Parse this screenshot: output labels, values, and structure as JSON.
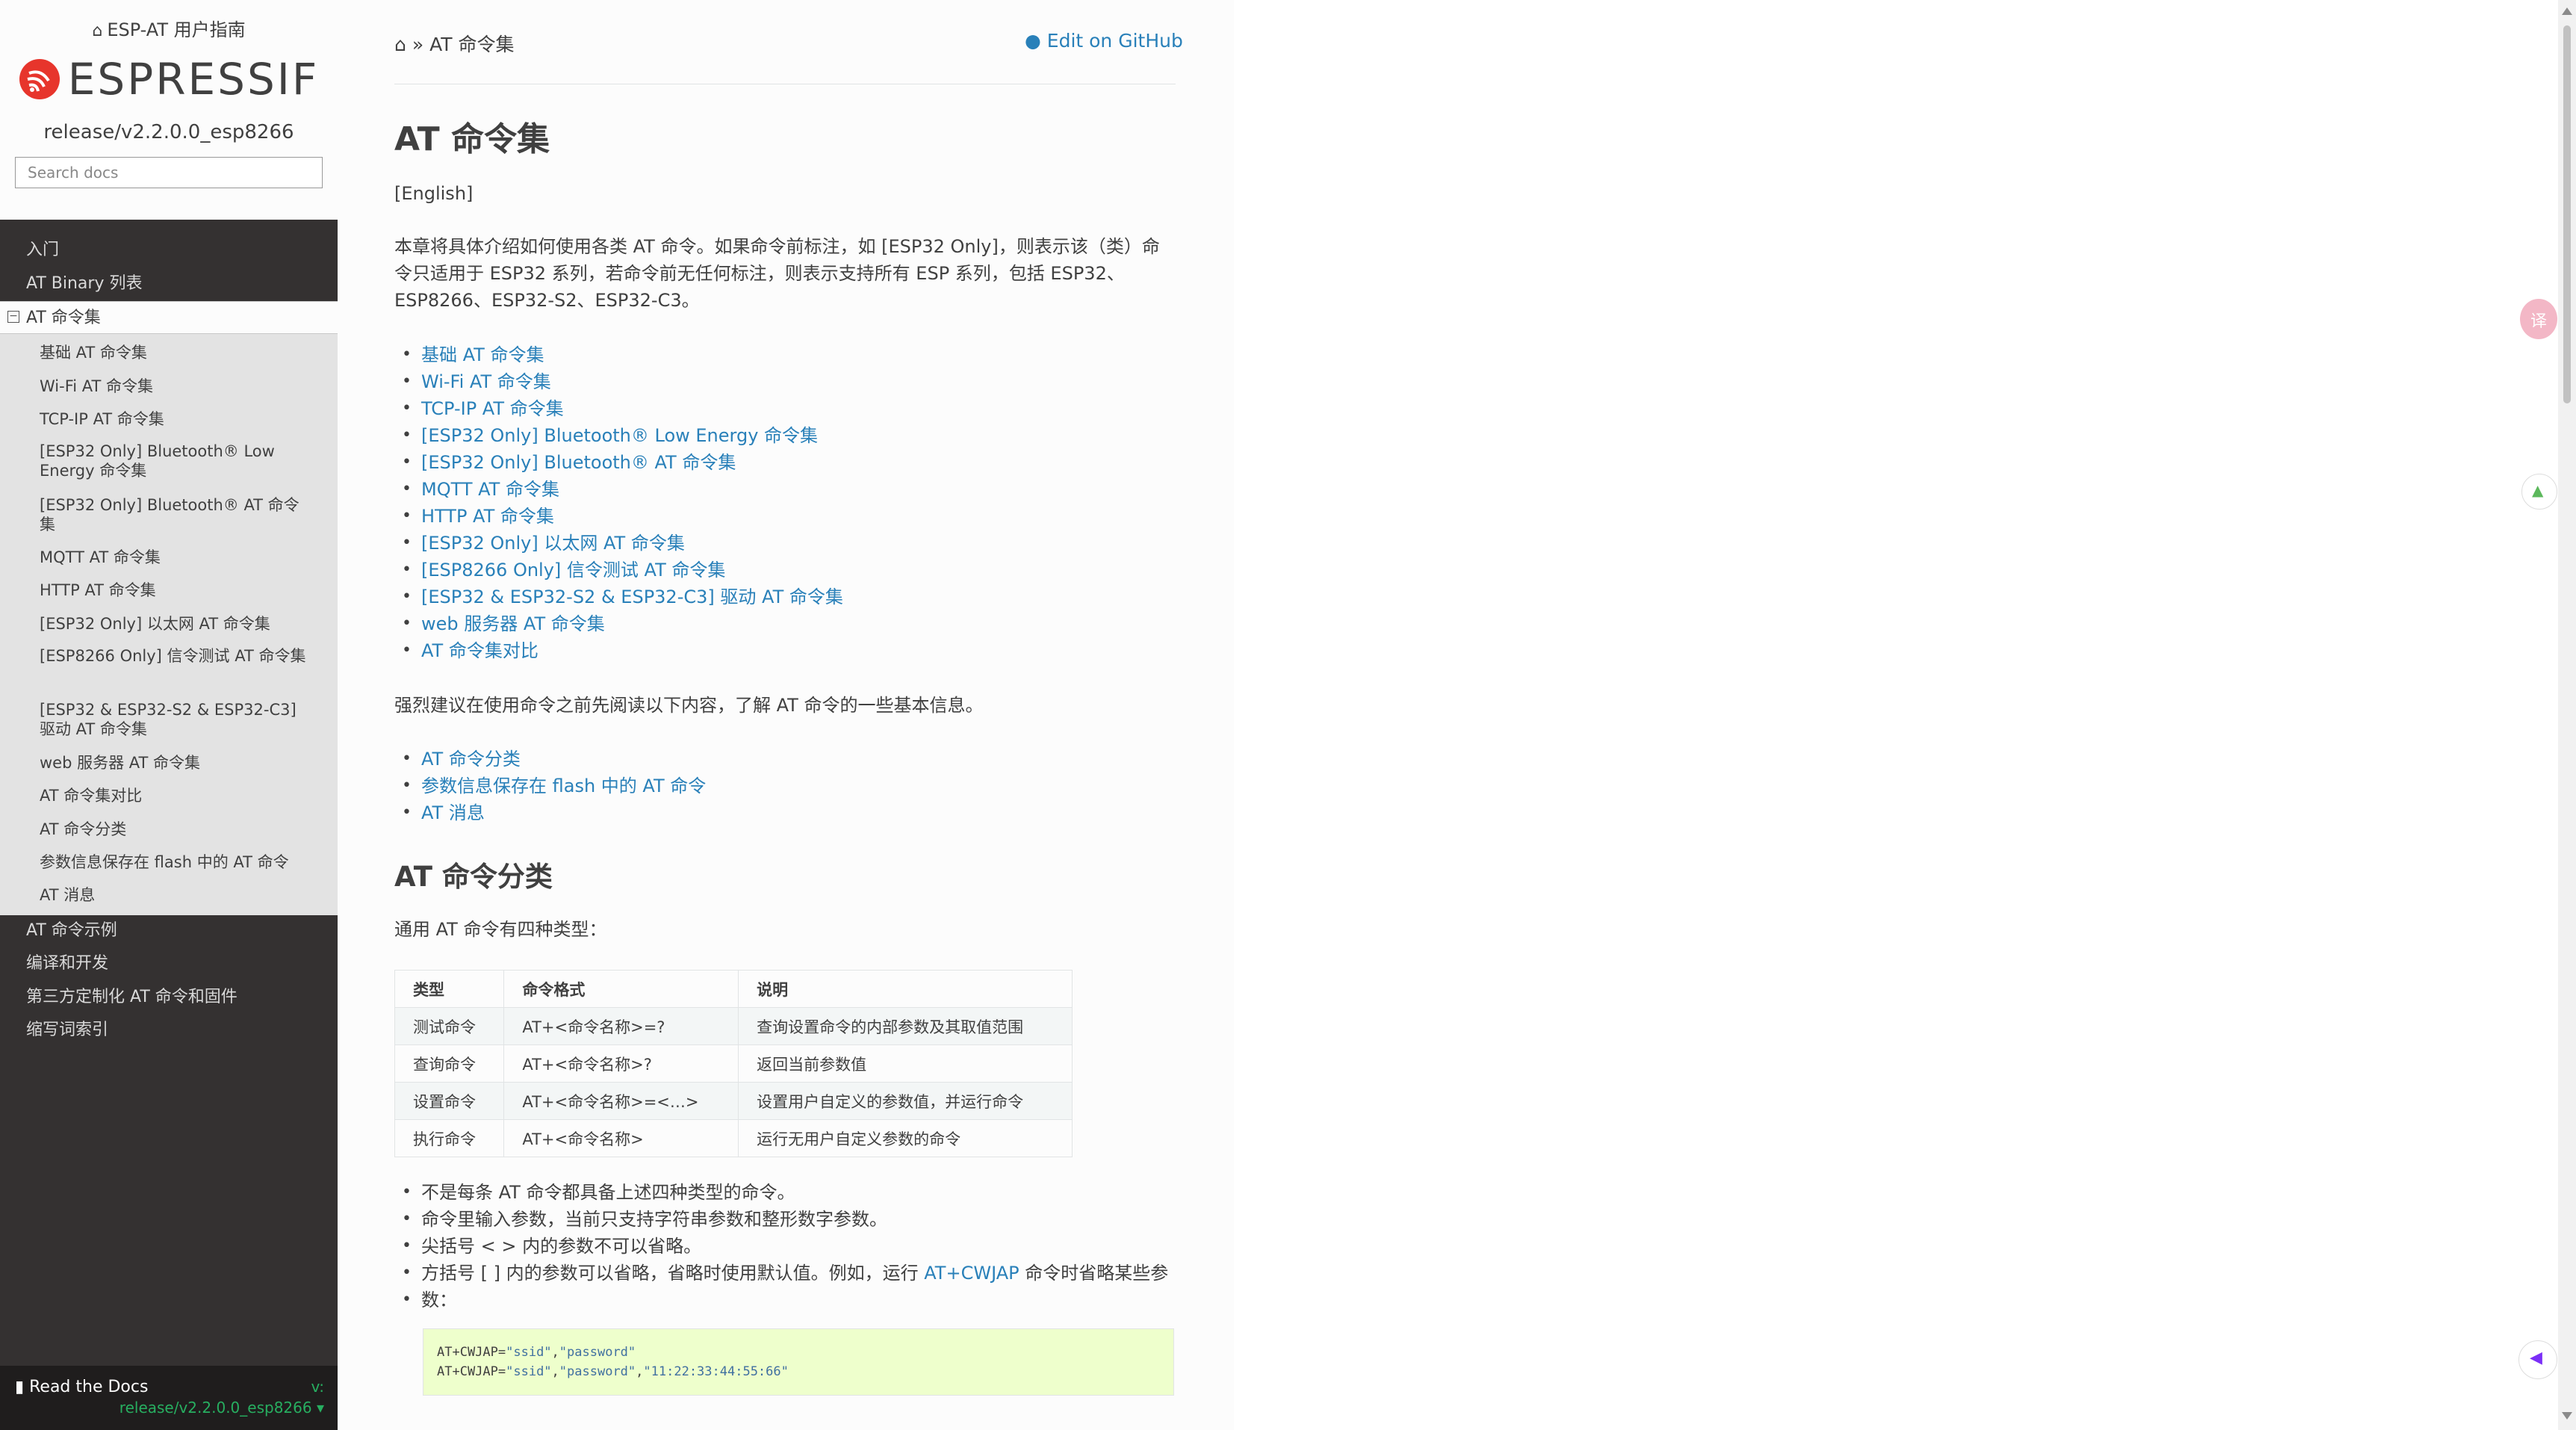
{
  "sidebar": {
    "project_title": "ESP-AT 用户指南",
    "logo_text": "ESPRESSIF",
    "version": "release/v2.2.0.0_esp8266",
    "search_placeholder": "Search docs",
    "nav": [
      {
        "label": "入门"
      },
      {
        "label": "AT Binary 列表"
      },
      {
        "label": "AT 命令集",
        "current": true
      },
      {
        "label": "AT 命令示例"
      },
      {
        "label": "编译和开发"
      },
      {
        "label": "第三方定制化 AT 命令和固件"
      },
      {
        "label": "缩写词索引"
      }
    ],
    "subnav": [
      {
        "label": "基础 AT 命令集"
      },
      {
        "label": "Wi-Fi AT 命令集"
      },
      {
        "label": "TCP-IP AT 命令集"
      },
      {
        "label": "[ESP32 Only] Bluetooth® Low Energy 命令集"
      },
      {
        "label": "[ESP32 Only] Bluetooth® AT 命令集"
      },
      {
        "label": "MQTT AT 命令集"
      },
      {
        "label": "HTTP AT 命令集"
      },
      {
        "label": "[ESP32 Only] 以太网 AT 命令集"
      },
      {
        "label": "[ESP8266 Only] 信令测试 AT 命令集"
      },
      {
        "label": "[ESP32 & ESP32-S2 & ESP32-C3] 驱动 AT 命令集"
      },
      {
        "label": "web 服务器 AT 命令集"
      },
      {
        "label": "AT 命令集对比"
      },
      {
        "label": "AT 命令分类"
      },
      {
        "label": "参数信息保存在 flash 中的 AT 命令"
      },
      {
        "label": "AT 消息"
      }
    ],
    "rtd": {
      "label": "Read the Docs",
      "v": "v:",
      "version": "release/v2.2.0.0_esp8266"
    }
  },
  "header": {
    "breadcrumb_sep": "»",
    "breadcrumb_current": "AT 命令集",
    "edit_link": "Edit on GitHub"
  },
  "main": {
    "title": "AT 命令集",
    "english_link": "[English]",
    "intro": "本章将具体介绍如何使用各类 AT 命令。如果命令前标注，如 [ESP32 Only]，则表示该（类）命令只适用于 ESP32 系列，若命令前无任何标注，则表示支持所有 ESP 系列，包括 ESP32、ESP8266、ESP32-S2、ESP32-C3。",
    "toc": [
      "基础 AT 命令集",
      "Wi-Fi AT 命令集",
      "TCP-IP AT 命令集",
      "[ESP32 Only] Bluetooth® Low Energy 命令集",
      "[ESP32 Only] Bluetooth® AT 命令集",
      "MQTT AT 命令集",
      "HTTP AT 命令集",
      "[ESP32 Only] 以太网 AT 命令集",
      "[ESP8266 Only] 信令测试 AT 命令集",
      "[ESP32 & ESP32-S2 & ESP32-C3] 驱动 AT 命令集",
      "web 服务器 AT 命令集",
      "AT 命令集对比"
    ],
    "recommend": "强烈建议在使用命令之前先阅读以下内容，了解 AT 命令的一些基本信息。",
    "toc2": [
      "AT 命令分类",
      "参数信息保存在 flash 中的 AT 命令",
      "AT 消息"
    ],
    "section_title": "AT 命令分类",
    "section_intro": "通用 AT 命令有四种类型：",
    "table": {
      "headers": [
        "类型",
        "命令格式",
        "说明"
      ],
      "rows": [
        [
          "测试命令",
          "AT+<命令名称>=?",
          "查询设置命令的内部参数及其取值范围"
        ],
        [
          "查询命令",
          "AT+<命令名称>?",
          "返回当前参数值"
        ],
        [
          "设置命令",
          "AT+<命令名称>=<…>",
          "设置用户自定义的参数值，并运行命令"
        ],
        [
          "执行命令",
          "AT+<命令名称>",
          "运行无用户自定义参数的命令"
        ]
      ]
    },
    "notes": [
      "不是每条 AT 命令都具备上述四种类型的命令。",
      "命令里输入参数，当前只支持字符串参数和整形数字参数。",
      "尖括号 < > 内的参数不可以省略。"
    ],
    "note4_prefix": "方括号 [ ] 内的参数可以省略，省略时使用默认值。例如，运行 ",
    "note4_link": "AT+CWJAP",
    "note4_suffix": " 命令时省略某些参",
    "note4_line2": "数：",
    "code": {
      "line1_cmd": "AT+CWJAP=",
      "line1_a": "\"ssid\"",
      "line1_sep": ",",
      "line1_b": "\"password\"",
      "line2_cmd": "AT+CWJAP=",
      "line2_a": "\"ssid\"",
      "line2_sep": ",",
      "line2_b": "\"password\"",
      "line2_sep2": ",",
      "line2_c": "\"11:22:33:44:55:66\""
    }
  },
  "colors": {
    "link": "#2980b9",
    "sidebar_bg": "#343131",
    "logo_red": "#e7352c",
    "rtd_green": "#27ae60"
  }
}
